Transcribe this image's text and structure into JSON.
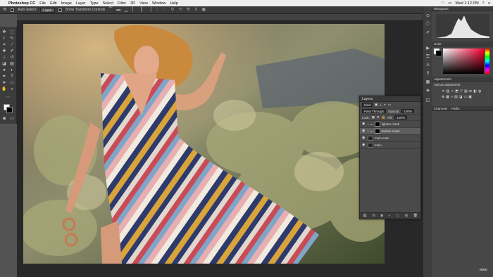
{
  "menubar": {
    "app_name": "Photoshop CC",
    "items": [
      "File",
      "Edit",
      "Image",
      "Layer",
      "Type",
      "Select",
      "Filter",
      "3D",
      "View",
      "Window",
      "Help"
    ],
    "clock": "Wed 1:12 PM"
  },
  "options_bar": {
    "auto_select_label": "Auto-Select:",
    "auto_select_value": "Layer",
    "transform_label": "Show Transform Controls"
  },
  "panels": {
    "histogram_tab": "Histogram",
    "color_tab": "Color",
    "adjustments_tab": "Adjustments",
    "add_adjustment": "Add an adjustment",
    "channels_tab": "Channels",
    "paths_tab": "Paths"
  },
  "layers": {
    "title": "Layers",
    "filter_kind": "Kind",
    "blend_mode": "Pass Through",
    "opacity_label": "Opacity:",
    "opacity_value": "100%",
    "lock_label": "Lock:",
    "fill_label": "Fill:",
    "fill_value": "100%",
    "items": [
      {
        "name": "lighten mask",
        "type": "group"
      },
      {
        "name": "darken mask",
        "type": "group"
      },
      {
        "name": "main matt",
        "type": "layer"
      },
      {
        "name": "main",
        "type": "layer"
      }
    ]
  },
  "watermark": "NINO",
  "colors": {
    "app_bg": "#535353",
    "panel_bg": "#464646",
    "menubar_bg": "#efefef"
  }
}
